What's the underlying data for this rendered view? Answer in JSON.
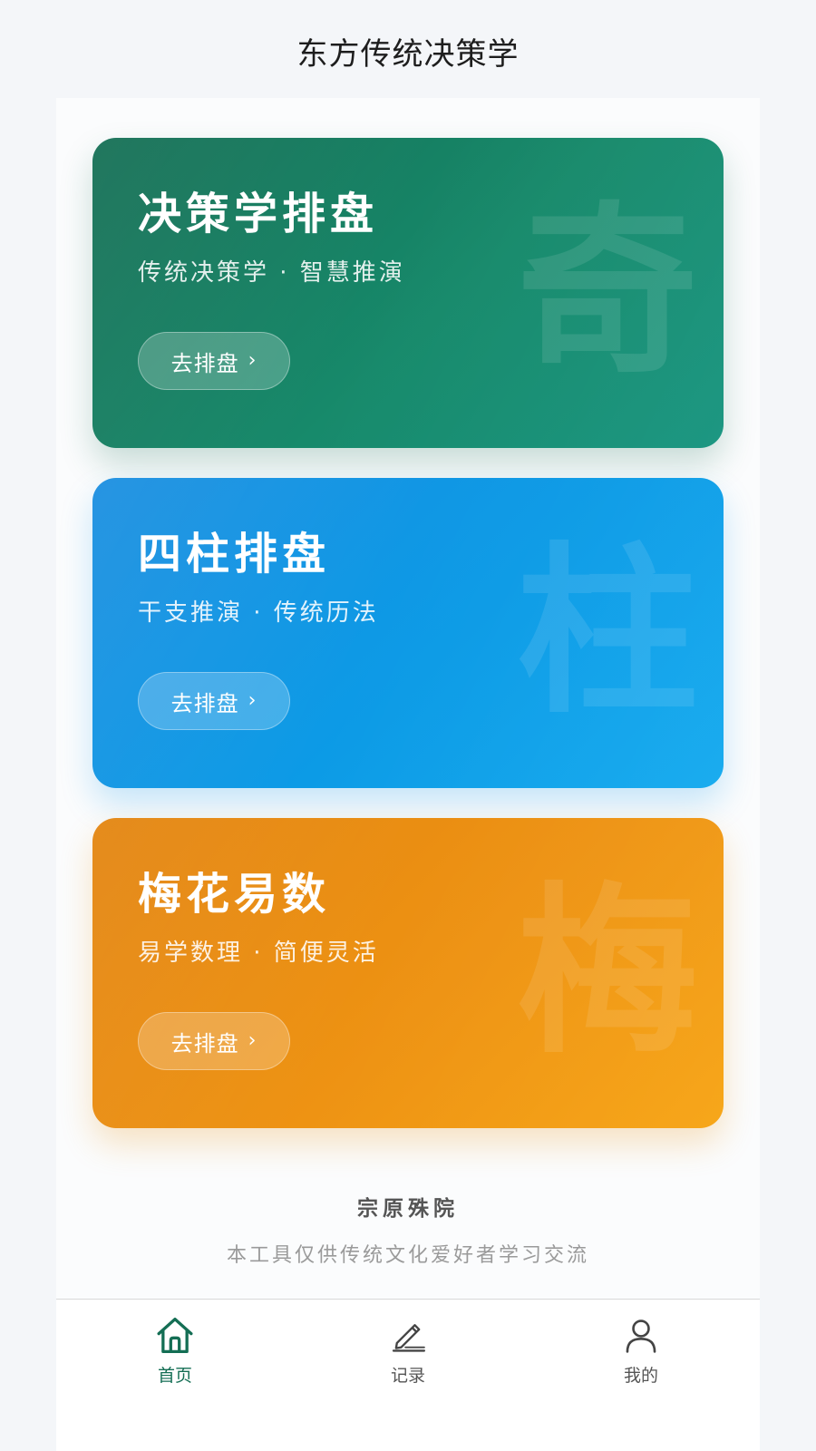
{
  "app": {
    "title": "东方传统决策学"
  },
  "colors": {
    "primary": "#146e54",
    "qimen_card": "#178a6b",
    "sizhu_card": "#0c9be6",
    "meihua_card": "#ee9313",
    "inactive_tab": "#555555"
  },
  "cards": [
    {
      "title": "决策学排盘",
      "subtitle": "传统决策学 · 智慧推演",
      "watermark": "奇",
      "button_label": "去排盘",
      "button_icon": "chevron-right-icon"
    },
    {
      "title": "四柱排盘",
      "subtitle": "干支推演 · 传统历法",
      "watermark": "柱",
      "button_label": "去排盘",
      "button_icon": "chevron-right-icon"
    },
    {
      "title": "梅花易数",
      "subtitle": "易学数理 · 简便灵活",
      "watermark": "梅",
      "button_label": "去排盘",
      "button_icon": "chevron-right-icon"
    }
  ],
  "footer": {
    "brand": "宗原殊院",
    "note": "本工具仅供传统文化爱好者学习交流"
  },
  "tabbar": {
    "items": [
      {
        "label": "首页",
        "icon": "home-icon",
        "active": true
      },
      {
        "label": "记录",
        "icon": "edit-icon",
        "active": false
      },
      {
        "label": "我的",
        "icon": "user-icon",
        "active": false
      }
    ]
  }
}
